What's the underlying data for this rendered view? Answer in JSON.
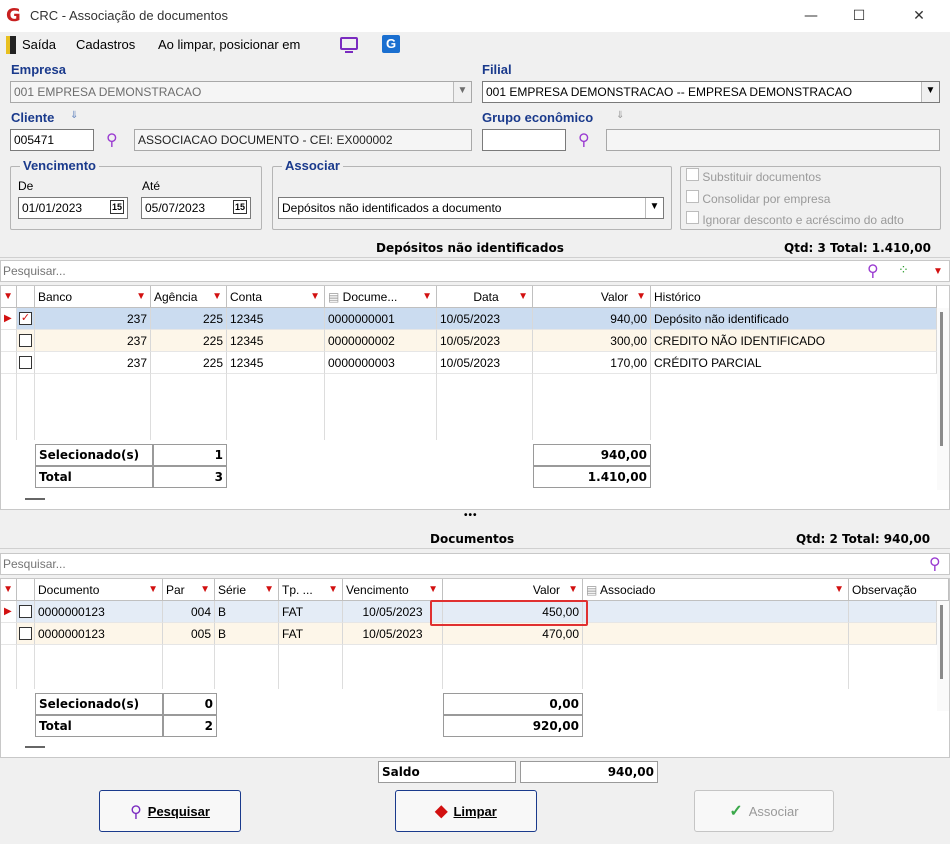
{
  "window": {
    "title": "CRC - Associação de documentos",
    "app_icon": "crc-logo-icon",
    "min": "—",
    "max": "☐",
    "close": "✕"
  },
  "menu": {
    "exit": "Saída",
    "register": "Cadastros",
    "clear_position": "Ao limpar, posicionar em"
  },
  "empresa": {
    "label": "Empresa",
    "value": "001 EMPRESA DEMONSTRACAO"
  },
  "filial": {
    "label": "Filial",
    "value": "001 EMPRESA DEMONSTRACAO -- EMPRESA DEMONSTRACAO"
  },
  "cliente": {
    "label": "Cliente",
    "code": "005471",
    "name": "ASSOCIACAO DOCUMENTO - CEI: EX000002"
  },
  "grupo": {
    "label": "Grupo econômico",
    "code": "",
    "name": ""
  },
  "vencimento": {
    "label": "Vencimento",
    "de_label": "De",
    "de": "01/01/2023",
    "ate_label": "Até",
    "ate": "05/07/2023",
    "cal": "15"
  },
  "associar": {
    "label": "Associar",
    "value": "Depósitos não identificados a documento"
  },
  "options": [
    "Substituir documentos",
    "Consolidar por empresa",
    "Ignorar desconto e acréscimo do adto"
  ],
  "depositos": {
    "title": "Depósitos não identificados",
    "summary": "Qtd: 3 Total: 1.410,00",
    "search_placeholder": "Pesquisar...",
    "columns": [
      "Banco",
      "Agência",
      "Conta",
      "Docume...",
      "Data",
      "Valor",
      "Histórico"
    ],
    "rows": [
      {
        "banco": "237",
        "agencia": "225",
        "conta": "12345",
        "doc": "0000000001",
        "data": "10/05/2023",
        "valor": "940,00",
        "hist": "Depósito não identificado",
        "checked": "✓"
      },
      {
        "banco": "237",
        "agencia": "225",
        "conta": "12345",
        "doc": "0000000002",
        "data": "10/05/2023",
        "valor": "300,00",
        "hist": "CREDITO NÃO IDENTIFICADO",
        "checked": ""
      },
      {
        "banco": "237",
        "agencia": "225",
        "conta": "12345",
        "doc": "0000000003",
        "data": "10/05/2023",
        "valor": "170,00",
        "hist": "CRÉDITO PARCIAL",
        "checked": ""
      }
    ],
    "sel_label": "Selecionado(s)",
    "sel_count": "1",
    "sel_value": "940,00",
    "total_label": "Total",
    "total_count": "3",
    "total_value": "1.410,00"
  },
  "splitter": "•••",
  "documentos": {
    "title": "Documentos",
    "summary": "Qtd: 2 Total: 940,00",
    "search_placeholder": "Pesquisar...",
    "columns": [
      "Documento",
      "Par",
      "Série",
      "Tp. ...",
      "Vencimento",
      "Valor",
      "Associado",
      "Observação"
    ],
    "rows": [
      {
        "doc": "0000000123",
        "par": "004",
        "serie": "B",
        "tp": "FAT",
        "venc": "10/05/2023",
        "valor": "450,00"
      },
      {
        "doc": "0000000123",
        "par": "005",
        "serie": "B",
        "tp": "FAT",
        "venc": "10/05/2023",
        "valor": "470,00"
      }
    ],
    "sel_label": "Selecionado(s)",
    "sel_count": "0",
    "sel_value": "0,00",
    "total_label": "Total",
    "total_count": "2",
    "total_value": "920,00"
  },
  "saldo": {
    "label": "Saldo",
    "value": "940,00"
  },
  "buttons": {
    "pesquisar": "Pesquisar",
    "limpar": "Limpar",
    "associar": "Associar"
  }
}
